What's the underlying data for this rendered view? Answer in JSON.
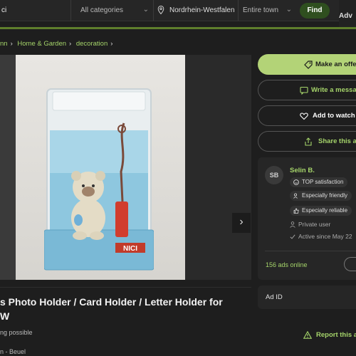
{
  "header": {
    "search_value": "ci",
    "category_label": "All categories",
    "location_value": "Nordrhein-Westfalen",
    "radius_label": "Entire town",
    "find_label": "Find",
    "post_label": "Adv"
  },
  "breadcrumb": {
    "items": [
      "nn",
      "Home & Garden",
      "decoration"
    ]
  },
  "gallery": {
    "image_count": "1"
  },
  "listing": {
    "title": "s Photo Holder / Card Holder / Letter Holder for\nW",
    "shipping": "ng possible",
    "location": "n - Beuel"
  },
  "actions": {
    "offer": "Make an offe",
    "message": "Write a messa",
    "watchlist": "Add to watch",
    "share": "Share this a"
  },
  "seller": {
    "initials": "SB",
    "name": "Selin B.",
    "badges": [
      "TOP satisfaction",
      "Especially friendly",
      "Especially reliable"
    ],
    "type": "Private user",
    "active_since": "Active since May 22",
    "ads_online": "156 ads online"
  },
  "details": {
    "ad_id_label": "Ad ID",
    "report_label": "Report this a"
  },
  "colors": {
    "accent_green": "#a5d46a",
    "primary_button": "#b3d377",
    "find_button": "#2f4f1f",
    "background": "#1e1e1e"
  }
}
